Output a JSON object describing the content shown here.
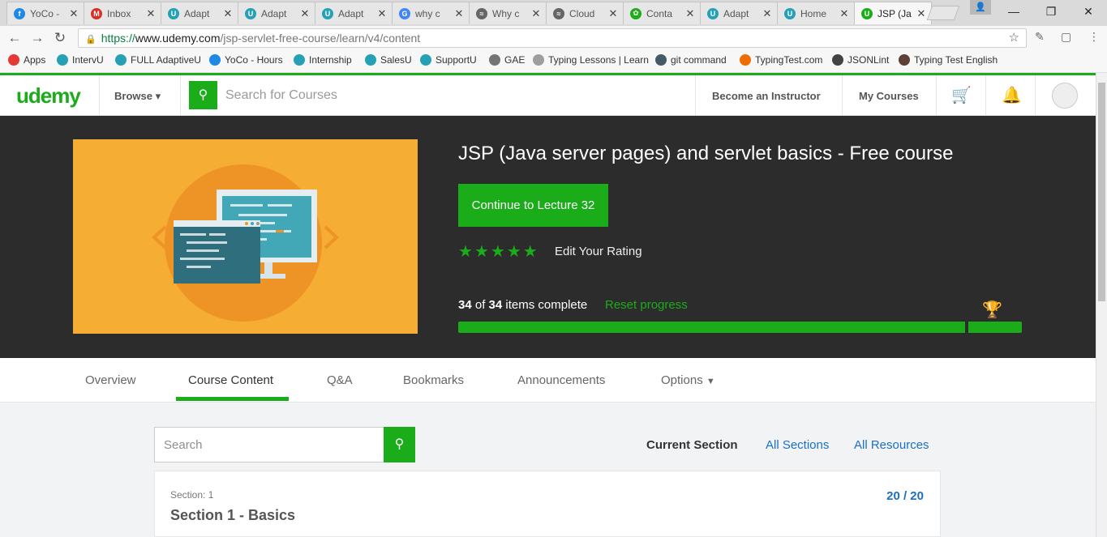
{
  "browser": {
    "tabs": [
      {
        "title": "YoCo -",
        "icon_color": "#1e88e5",
        "icon": "yoco-icon"
      },
      {
        "title": "Inbox",
        "icon_color": "#d93025",
        "icon": "gmail-icon"
      },
      {
        "title": "Adapt",
        "icon_color": "#26a0b4",
        "icon": "udemy-u-icon"
      },
      {
        "title": "Adapt",
        "icon_color": "#26a0b4",
        "icon": "udemy-u-icon"
      },
      {
        "title": "Adapt",
        "icon_color": "#26a0b4",
        "icon": "udemy-u-icon"
      },
      {
        "title": "why c",
        "icon_color": "#4285f4",
        "icon": "google-icon"
      },
      {
        "title": "Why c",
        "icon_color": "#666666",
        "icon": "stack-icon"
      },
      {
        "title": "Cloud",
        "icon_color": "#666666",
        "icon": "stack-icon"
      },
      {
        "title": "Conta",
        "icon_color": "#1aad19",
        "icon": "contact-icon"
      },
      {
        "title": "Adapt",
        "icon_color": "#26a0b4",
        "icon": "udemy-u-icon"
      },
      {
        "title": "Home",
        "icon_color": "#26a0b4",
        "icon": "home-u-icon"
      },
      {
        "title": "JSP (Ja",
        "icon_color": "#1aad19",
        "icon": "udemy-u-icon",
        "active": true
      }
    ],
    "url_scheme": "https://",
    "url_domain": "www.udemy.com",
    "url_path": "/jsp-servlet-free-course/learn/v4/content",
    "bookmarks": [
      {
        "label": "Apps",
        "icon_color": "#e53935"
      },
      {
        "label": "IntervU",
        "icon_color": "#26a0b4"
      },
      {
        "label": "FULL AdaptiveU",
        "icon_color": "#26a0b4"
      },
      {
        "label": "YoCo - Hours",
        "icon_color": "#1e88e5"
      },
      {
        "label": "Internship",
        "icon_color": "#26a0b4"
      },
      {
        "label": "SalesU",
        "icon_color": "#26a0b4"
      },
      {
        "label": "SupportU",
        "icon_color": "#26a0b4"
      },
      {
        "label": "GAE",
        "icon_color": "#757575"
      },
      {
        "label": "Typing Lessons | Learn",
        "icon_color": "#9e9e9e"
      },
      {
        "label": "git command",
        "icon_color": "#455a64"
      },
      {
        "label": "TypingTest.com",
        "icon_color": "#ef6c00"
      },
      {
        "label": "JSONLint",
        "icon_color": "#424242"
      },
      {
        "label": "Typing Test English",
        "icon_color": "#5d4037"
      }
    ]
  },
  "header": {
    "logo": "udemy",
    "browse_label": "Browse ▾",
    "search_placeholder": "Search for Courses",
    "become_instructor": "Become an Instructor",
    "my_courses": "My Courses"
  },
  "course": {
    "title": "JSP (Java server pages) and servlet basics - Free course",
    "continue_label": "Continue to Lecture 32",
    "rating_stars": 5,
    "edit_rating": "Edit Your Rating",
    "completed": "34",
    "total": "34",
    "of_text": "of",
    "items_complete_text": "items complete",
    "reset_progress": "Reset progress",
    "progress_fraction": 1.0,
    "accent_color": "#1aad19"
  },
  "course_tabs": {
    "overview": "Overview",
    "content": "Course Content",
    "qa": "Q&A",
    "bookmarks": "Bookmarks",
    "announcements": "Announcements",
    "options": "Options"
  },
  "content": {
    "search_placeholder": "Search",
    "current_section": "Current Section",
    "all_sections": "All Sections",
    "all_resources": "All Resources",
    "section_number": "Section: 1",
    "section_title": "Section 1 - Basics",
    "section_count": "20 / 20"
  }
}
